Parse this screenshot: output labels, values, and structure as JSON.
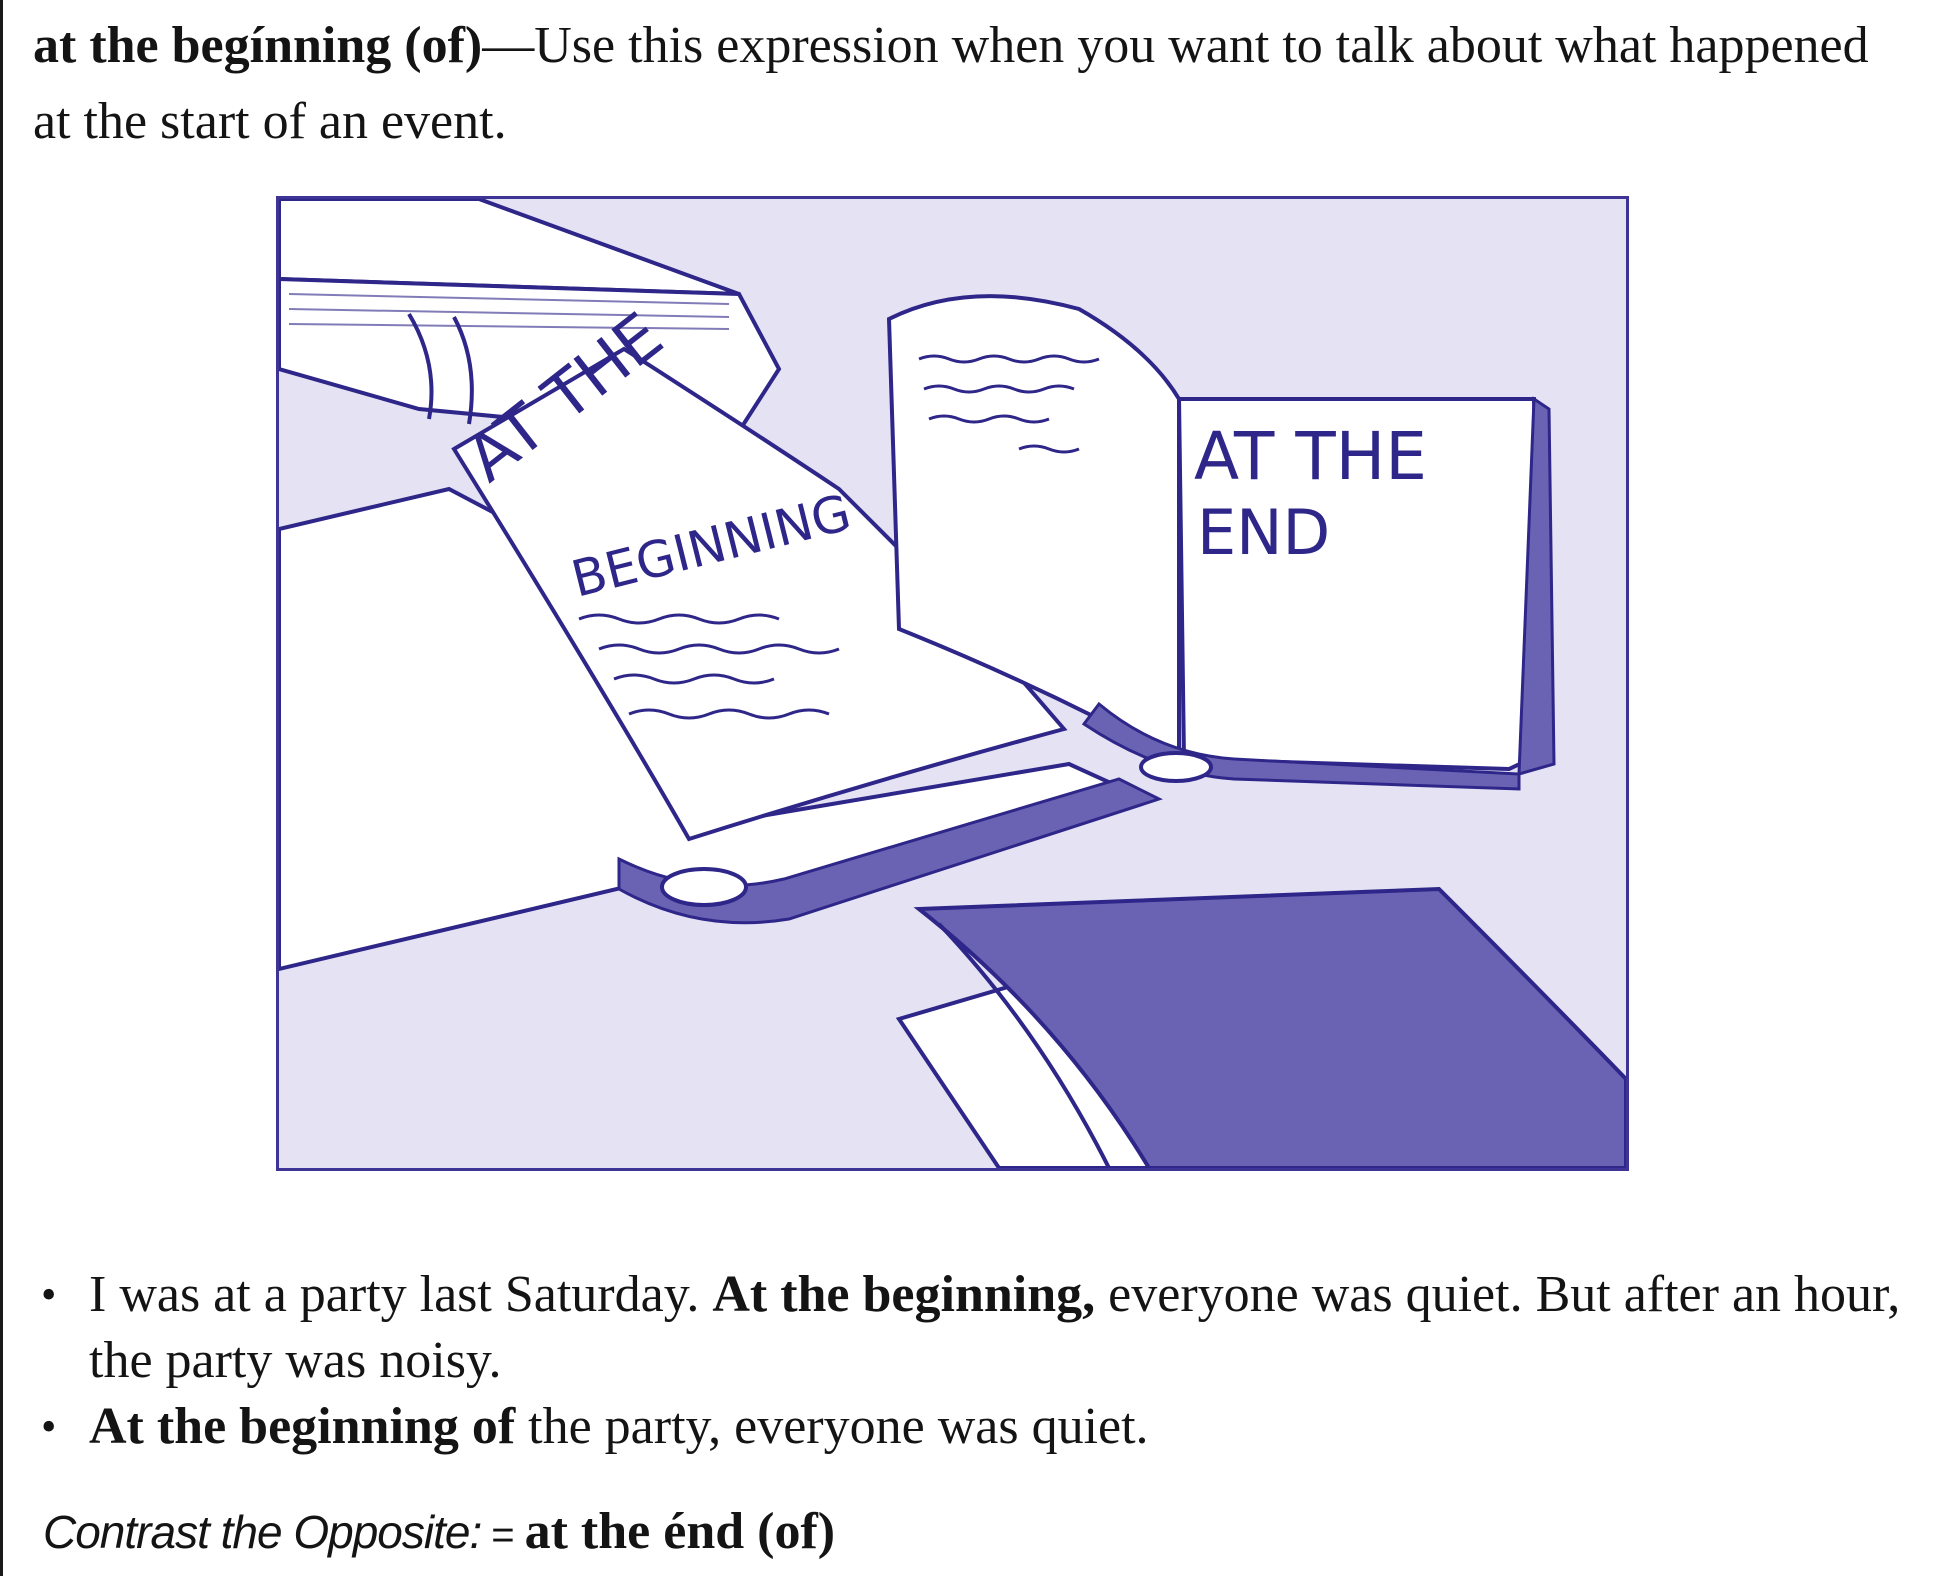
{
  "definition": {
    "term": "at the begínning (of)",
    "dash": "—",
    "text": "Use this expression when you want to talk about what happened at the start of an event."
  },
  "illustration": {
    "book_left_line1": "AT THE",
    "book_left_line2": "BEGINNING",
    "book_right_line1": "AT THE",
    "book_right_line2": "END",
    "colors": {
      "ink": "#2e2688",
      "tint": "#e4e2f3",
      "dark_cover": "#6a63b4",
      "paper": "#ffffff"
    }
  },
  "examples": [
    {
      "bullet": "•",
      "before": "I was at a party last Saturday. ",
      "bold": "At the beginning,",
      "after": " everyone was quiet. But after an hour, the party was noisy."
    },
    {
      "bullet": "•",
      "before": "",
      "bold": "At the beginning of",
      "after": " the party, everyone was quiet."
    }
  ],
  "contrast": {
    "label": "Contrast the Opposite:",
    "equals": "=",
    "opposite": "at the énd (of)"
  }
}
